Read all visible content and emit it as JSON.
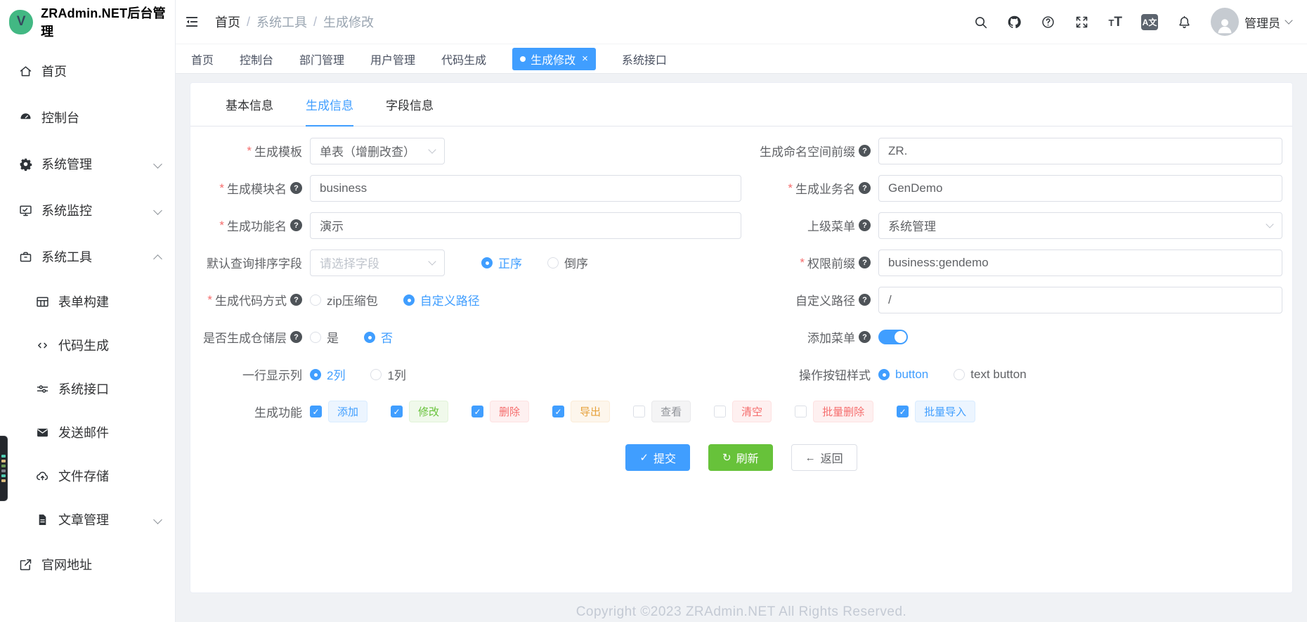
{
  "app": {
    "logo_letter": "V",
    "title": "ZRAdmin.NET后台管理"
  },
  "breadcrumb": {
    "sep": "/",
    "items": [
      "首页",
      "系统工具",
      "生成修改"
    ]
  },
  "header": {
    "font_size_label": "TT",
    "language_label": "A文",
    "user_name": "管理员",
    "icon_names": [
      "search-icon",
      "github-icon",
      "help-icon",
      "fullscreen-icon",
      "font-size-icon",
      "language-icon",
      "bell-icon"
    ]
  },
  "sidebar": {
    "menu": [
      {
        "name": "home",
        "label": "首页",
        "icon": "home-icon",
        "type": "item"
      },
      {
        "name": "console",
        "label": "控制台",
        "icon": "dashboard-icon",
        "type": "item"
      },
      {
        "name": "system-management",
        "label": "系统管理",
        "icon": "gear-icon",
        "type": "submenu",
        "state": "collapsed"
      },
      {
        "name": "system-monitor",
        "label": "系统监控",
        "icon": "monitor-icon",
        "type": "submenu",
        "state": "collapsed"
      },
      {
        "name": "system-tools",
        "label": "系统工具",
        "icon": "toolbox-icon",
        "type": "submenu",
        "state": "expanded",
        "children": [
          {
            "name": "form-builder",
            "label": "表单构建",
            "icon": "form-grid-icon"
          },
          {
            "name": "code-generation",
            "label": "代码生成",
            "icon": "code-icon"
          },
          {
            "name": "system-api",
            "label": "系统接口",
            "icon": "sliders-icon"
          },
          {
            "name": "send-mail",
            "label": "发送邮件",
            "icon": "mail-icon"
          },
          {
            "name": "file-storage",
            "label": "文件存储",
            "icon": "cloud-upload-icon"
          },
          {
            "name": "article-management",
            "label": "文章管理",
            "icon": "article-icon",
            "expandable": true
          }
        ]
      },
      {
        "name": "official-site",
        "label": "官网地址",
        "icon": "external-link-icon",
        "type": "item"
      }
    ]
  },
  "tags_bar": {
    "tabs": [
      {
        "name": "home",
        "label": "首页"
      },
      {
        "name": "console",
        "label": "控制台"
      },
      {
        "name": "dept-management",
        "label": "部门管理"
      },
      {
        "name": "user-management",
        "label": "用户管理"
      },
      {
        "name": "code-generation",
        "label": "代码生成"
      },
      {
        "name": "gen-edit",
        "label": "生成修改",
        "active": true,
        "closable": true,
        "close_glyph": "×"
      },
      {
        "name": "system-api",
        "label": "系统接口"
      }
    ]
  },
  "panel": {
    "tabs": [
      {
        "name": "basic-info",
        "label": "基本信息"
      },
      {
        "name": "gen-info",
        "label": "生成信息",
        "active": true
      },
      {
        "name": "field-info",
        "label": "字段信息"
      }
    ]
  },
  "form": {
    "left": [
      {
        "name": "gen-template",
        "label": "生成模板",
        "required": true,
        "help": false,
        "type": "select",
        "value": "单表（增删改查）",
        "narrow": true
      },
      {
        "name": "gen-module-name",
        "label": "生成模块名",
        "required": true,
        "help": true,
        "type": "input",
        "value": "business"
      },
      {
        "name": "gen-function-name",
        "label": "生成功能名",
        "required": true,
        "help": true,
        "type": "input",
        "value": "演示"
      },
      {
        "name": "default-sort-field",
        "label": "默认查询排序字段",
        "required": false,
        "help": false,
        "type": "select-radios",
        "placeholder": "请选择字段",
        "narrow": true,
        "radios": [
          {
            "label": "正序",
            "checked": true
          },
          {
            "label": "倒序",
            "checked": false
          }
        ]
      },
      {
        "name": "gen-code-method",
        "label": "生成代码方式",
        "required": true,
        "help": true,
        "type": "radios",
        "radios": [
          {
            "label": "zip压缩包",
            "checked": false
          },
          {
            "label": "自定义路径",
            "checked": true
          }
        ]
      },
      {
        "name": "gen-repository-layer",
        "label": "是否生成仓储层",
        "required": false,
        "help": true,
        "type": "radios",
        "radios": [
          {
            "label": "是",
            "checked": false
          },
          {
            "label": "否",
            "checked": true
          }
        ]
      },
      {
        "name": "columns-per-row",
        "label": "一行显示列",
        "required": false,
        "help": false,
        "type": "radios",
        "radios": [
          {
            "label": "2列",
            "checked": true
          },
          {
            "label": "1列",
            "checked": false
          }
        ]
      }
    ],
    "right": [
      {
        "name": "namespace-prefix",
        "label": "生成命名空间前缀",
        "required": false,
        "help": true,
        "type": "input",
        "value": "ZR."
      },
      {
        "name": "gen-business-name",
        "label": "生成业务名",
        "required": true,
        "help": true,
        "type": "input",
        "value": "GenDemo"
      },
      {
        "name": "parent-menu",
        "label": "上级菜单",
        "required": false,
        "help": true,
        "type": "select",
        "value": "系统管理"
      },
      {
        "name": "permission-prefix",
        "label": "权限前缀",
        "required": true,
        "help": true,
        "type": "input",
        "value": "business:gendemo"
      },
      {
        "name": "custom-path",
        "label": "自定义路径",
        "required": false,
        "help": true,
        "type": "input",
        "value": "/"
      },
      {
        "name": "add-menu",
        "label": "添加菜单",
        "required": false,
        "help": true,
        "type": "switch",
        "value": true
      },
      {
        "name": "button-style",
        "label": "操作按钮样式",
        "required": false,
        "help": false,
        "type": "radios",
        "radios": [
          {
            "label": "button",
            "checked": true
          },
          {
            "label": "text button",
            "checked": false
          }
        ]
      }
    ],
    "functions_row": {
      "name": "gen-functions",
      "label": "生成功能",
      "options": [
        {
          "label": "添加",
          "checked": true,
          "color": "primary"
        },
        {
          "label": "修改",
          "checked": true,
          "color": "success"
        },
        {
          "label": "删除",
          "checked": true,
          "color": "danger"
        },
        {
          "label": "导出",
          "checked": true,
          "color": "warning"
        },
        {
          "label": "查看",
          "checked": false,
          "color": "info"
        },
        {
          "label": "清空",
          "checked": false,
          "color": "danger"
        },
        {
          "label": "批量删除",
          "checked": false,
          "color": "danger"
        },
        {
          "label": "批量导入",
          "checked": true,
          "color": "primary"
        }
      ]
    }
  },
  "actions": {
    "submit": "提交",
    "submit_icon": "✓",
    "refresh": "刷新",
    "refresh_icon": "↻",
    "back": "返回",
    "back_icon": "←"
  },
  "footer": {
    "copyright": "Copyright ©2023 ZRAdmin.NET All Rights Reserved."
  },
  "colors": {
    "primary": "#409eff",
    "success": "#67c23a",
    "danger": "#f56c6c",
    "warning": "#e6a23c",
    "info": "#909399",
    "logo": "#42b883",
    "dock_stripes": [
      "#4ec9b0",
      "#d7ba7d",
      "#6a9955",
      "#7d848c",
      "#4ec9b0",
      "#d7ba7d"
    ]
  }
}
